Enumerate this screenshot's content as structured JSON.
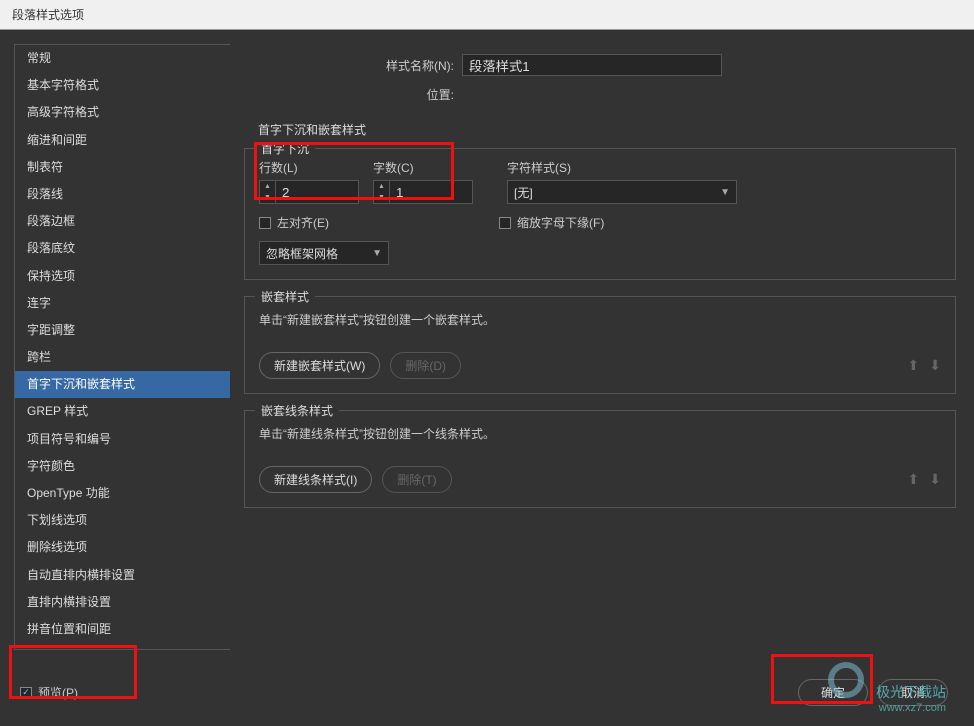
{
  "dialog": {
    "title": "段落样式选项",
    "style_name_label": "样式名称(N):",
    "style_name_value": "段落样式1",
    "position_label": "位置:",
    "section_title": "首字下沉和嵌套样式"
  },
  "sidebar": {
    "items": [
      {
        "label": "常规"
      },
      {
        "label": "基本字符格式"
      },
      {
        "label": "高级字符格式"
      },
      {
        "label": "缩进和间距"
      },
      {
        "label": "制表符"
      },
      {
        "label": "段落线"
      },
      {
        "label": "段落边框"
      },
      {
        "label": "段落底纹"
      },
      {
        "label": "保持选项"
      },
      {
        "label": "连字"
      },
      {
        "label": "字距调整"
      },
      {
        "label": "跨栏"
      },
      {
        "label": "首字下沉和嵌套样式"
      },
      {
        "label": "GREP 样式"
      },
      {
        "label": "项目符号和编号"
      },
      {
        "label": "字符颜色"
      },
      {
        "label": "OpenType 功能"
      },
      {
        "label": "下划线选项"
      },
      {
        "label": "删除线选项"
      },
      {
        "label": "自动直排内横排设置"
      },
      {
        "label": "直排内横排设置"
      },
      {
        "label": "拼音位置和间距"
      }
    ],
    "active_index": 12
  },
  "dropcap": {
    "legend": "首字下沉",
    "lines_label": "行数(L)",
    "lines_value": "2",
    "chars_label": "字数(C)",
    "chars_value": "1",
    "charstyle_label": "字符样式(S)",
    "charstyle_value": "[无]",
    "align_left_label": "左对齐(E)",
    "scale_label": "缩放字母下缘(F)",
    "ignore_grid_label": "忽略框架网格"
  },
  "nested": {
    "legend": "嵌套样式",
    "desc": "单击“新建嵌套样式”按钮创建一个嵌套样式。",
    "new_btn": "新建嵌套样式(W)",
    "del_btn": "删除(D)"
  },
  "nested_line": {
    "legend": "嵌套线条样式",
    "desc": "单击“新建线条样式”按钮创建一个线条样式。",
    "new_btn": "新建线条样式(I)",
    "del_btn": "删除(T)"
  },
  "footer": {
    "preview_label": "预览(P)",
    "ok": "确定",
    "cancel": "取消"
  },
  "watermark": {
    "line1": "极光下载站",
    "line2": "www.xz7.com"
  }
}
